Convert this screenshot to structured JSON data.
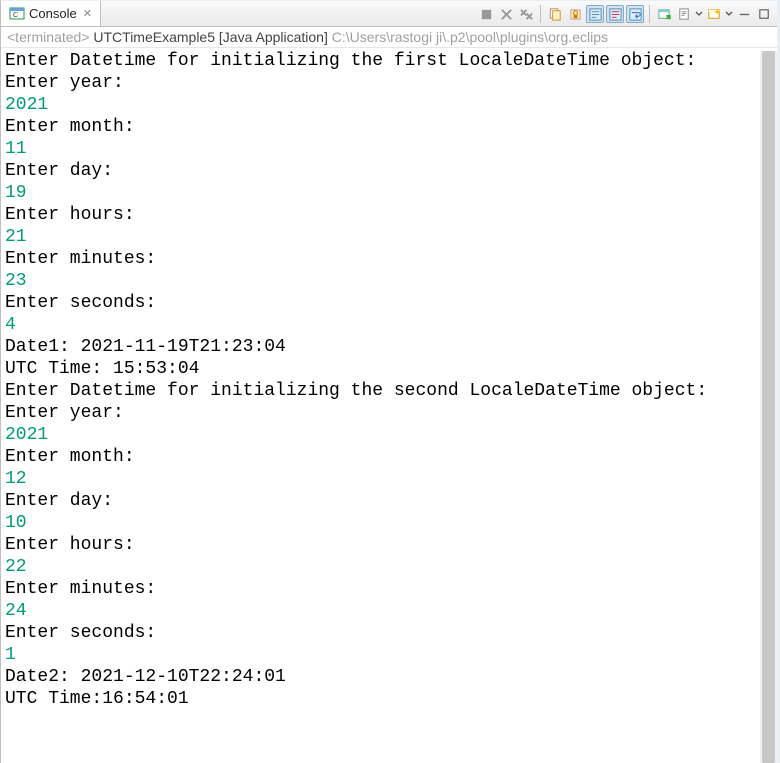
{
  "tab": {
    "title": "Console",
    "close": "✕"
  },
  "launch": {
    "prefix": "<terminated>",
    "label": " UTCTimeExample5 [Java Application] ",
    "path": "C:\\Users\\rastogi ji\\.p2\\pool\\plugins\\org.eclips"
  },
  "console_lines": [
    {
      "t": "Enter Datetime for initializing the first LocaleDateTime object:",
      "c": "out"
    },
    {
      "t": "Enter year:",
      "c": "out"
    },
    {
      "t": "2021",
      "c": "in"
    },
    {
      "t": "Enter month:",
      "c": "out"
    },
    {
      "t": "11",
      "c": "in"
    },
    {
      "t": "Enter day:",
      "c": "out"
    },
    {
      "t": "19",
      "c": "in"
    },
    {
      "t": "Enter hours:",
      "c": "out"
    },
    {
      "t": "21",
      "c": "in"
    },
    {
      "t": "Enter minutes:",
      "c": "out"
    },
    {
      "t": "23",
      "c": "in"
    },
    {
      "t": "Enter seconds:",
      "c": "out"
    },
    {
      "t": "4",
      "c": "in"
    },
    {
      "t": "Date1: 2021-11-19T21:23:04",
      "c": "out"
    },
    {
      "t": "UTC Time: 15:53:04",
      "c": "out"
    },
    {
      "t": "Enter Datetime for initializing the second LocaleDateTime object:",
      "c": "out"
    },
    {
      "t": "Enter year:",
      "c": "out"
    },
    {
      "t": "2021",
      "c": "in"
    },
    {
      "t": "Enter month:",
      "c": "out"
    },
    {
      "t": "12",
      "c": "in"
    },
    {
      "t": "Enter day:",
      "c": "out"
    },
    {
      "t": "10",
      "c": "in"
    },
    {
      "t": "Enter hours:",
      "c": "out"
    },
    {
      "t": "22",
      "c": "in"
    },
    {
      "t": "Enter minutes:",
      "c": "out"
    },
    {
      "t": "24",
      "c": "in"
    },
    {
      "t": "Enter seconds:",
      "c": "out"
    },
    {
      "t": "1",
      "c": "in"
    },
    {
      "t": "Date2: 2021-12-10T22:24:01",
      "c": "out"
    },
    {
      "t": "UTC Time:16:54:01",
      "c": "out"
    }
  ],
  "icons": {
    "console": "▢",
    "stop": "■",
    "x1": "✖",
    "xx": "✖✖",
    "doc1": "📄",
    "doc2": "📄",
    "wrap": "☰",
    "lock": "🔒",
    "edit": "✎",
    "monitor": "🖥",
    "share": "↗",
    "note": "📋",
    "dd": "▾",
    "new": "▭",
    "min": "—",
    "max": "▫"
  }
}
